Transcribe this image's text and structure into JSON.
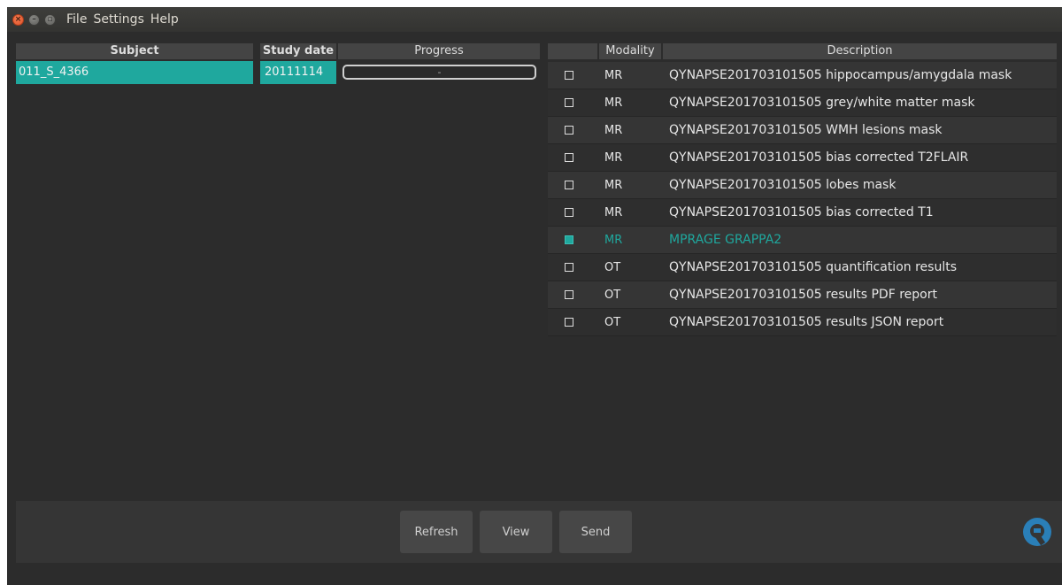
{
  "window": {
    "menu": [
      "File",
      "Settings",
      "Help"
    ]
  },
  "subjects_table": {
    "headers": {
      "subject": "Subject",
      "study_date": "Study date",
      "progress": "Progress"
    },
    "rows": [
      {
        "subject": "011_S_4366",
        "study_date": "20111114",
        "progress": "-"
      }
    ]
  },
  "series_table": {
    "headers": {
      "check": "",
      "modality": "Modality",
      "description": "Description"
    },
    "rows": [
      {
        "checked": false,
        "modality": "MR",
        "description": "QYNAPSE201703101505 hippocampus/amygdala mask"
      },
      {
        "checked": false,
        "modality": "MR",
        "description": "QYNAPSE201703101505 grey/white matter mask"
      },
      {
        "checked": false,
        "modality": "MR",
        "description": "QYNAPSE201703101505 WMH lesions mask"
      },
      {
        "checked": false,
        "modality": "MR",
        "description": "QYNAPSE201703101505 bias corrected T2FLAIR"
      },
      {
        "checked": false,
        "modality": "MR",
        "description": "QYNAPSE201703101505 lobes mask"
      },
      {
        "checked": false,
        "modality": "MR",
        "description": "QYNAPSE201703101505 bias corrected T1"
      },
      {
        "checked": true,
        "modality": "MR",
        "description": "MPRAGE GRAPPA2"
      },
      {
        "checked": false,
        "modality": "OT",
        "description": "QYNAPSE201703101505 quantification results"
      },
      {
        "checked": false,
        "modality": "OT",
        "description": "QYNAPSE201703101505 results PDF report"
      },
      {
        "checked": false,
        "modality": "OT",
        "description": "QYNAPSE201703101505 results JSON report"
      }
    ]
  },
  "buttons": {
    "refresh": "Refresh",
    "view": "View",
    "send": "Send"
  },
  "colors": {
    "accent": "#1fa89e",
    "background": "#2c2c2c",
    "logo": "#2a7fb8"
  },
  "icons": {
    "logo": "qynapse-logo-icon"
  }
}
